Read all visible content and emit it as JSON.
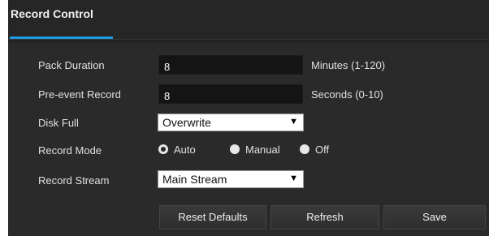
{
  "tab": {
    "title": "Record Control"
  },
  "fields": {
    "pack_duration": {
      "label": "Pack Duration",
      "value": "8",
      "unit": "Minutes (1-120)"
    },
    "pre_event": {
      "label": "Pre-event Record",
      "value": "8",
      "unit": "Seconds (0-10)"
    },
    "disk_full": {
      "label": "Disk Full",
      "selected": "Overwrite"
    },
    "record_mode": {
      "label": "Record Mode",
      "options": [
        "Auto",
        "Manual",
        "Off"
      ],
      "selected": "Auto"
    },
    "record_stream": {
      "label": "Record Stream",
      "selected": "Main Stream"
    }
  },
  "buttons": {
    "reset": "Reset Defaults",
    "refresh": "Refresh",
    "save": "Save"
  },
  "colors": {
    "accent": "#1e9ae0",
    "panel": "#2a2a2a"
  }
}
